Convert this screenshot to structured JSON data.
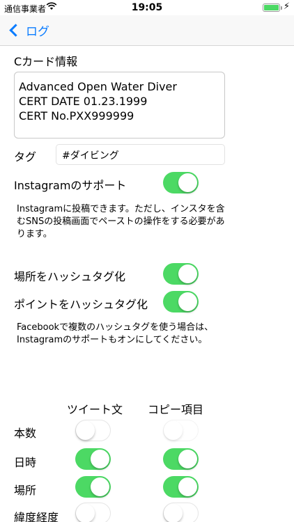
{
  "status_bar": {
    "carrier": "通信事業者",
    "time": "19:05",
    "battery_level": 1.0,
    "icons": [
      "wifi-icon",
      "battery-icon",
      "charging-bolt-icon"
    ]
  },
  "nav": {
    "back_label": "ログ",
    "back_icon": "chevron-left-icon"
  },
  "card": {
    "heading": "Cカード情報",
    "text": "Advanced Open Water Diver\nCERT DATE 01.23.1999\nCERT No.PXX999999"
  },
  "tag": {
    "label": "タグ",
    "value": "#ダイビング"
  },
  "instagram": {
    "label": "Instagramのサポート",
    "enabled": true,
    "note": "Instagramに投稿できます。ただし、インスタを含むSNSの投稿画面でペーストの操作をする必要があります。"
  },
  "hashtag": {
    "place_label": "場所をハッシュタグ化",
    "place_enabled": true,
    "point_label": "ポイントをハッシュタグ化",
    "point_enabled": true,
    "note": "Facebookで複数のハッシュタグを使う場合は、Instagramのサポートもオンにしてください。"
  },
  "columns": {
    "tweet": "ツイート文",
    "copy": "コピー項目"
  },
  "rows": [
    {
      "label": "本数",
      "tweet": false,
      "copy": false,
      "copy_disabled": true
    },
    {
      "label": "日時",
      "tweet": true,
      "copy": true,
      "copy_disabled": false
    },
    {
      "label": "場所",
      "tweet": true,
      "copy": true,
      "copy_disabled": false
    },
    {
      "label": "緯度経度",
      "tweet": false,
      "copy": false,
      "copy_disabled": false
    }
  ],
  "colors": {
    "accent": "#0a7cff",
    "toggle_on": "#4cd964"
  }
}
